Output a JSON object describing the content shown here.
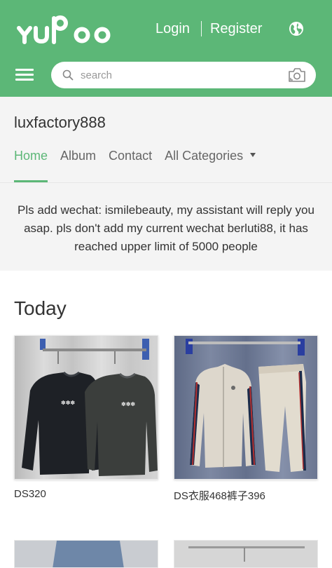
{
  "header": {
    "brand": "yupoo",
    "login_label": "Login",
    "register_label": "Register",
    "language_icon": "globe-icon",
    "menu_icon": "hamburger-icon"
  },
  "search": {
    "placeholder": "search",
    "icon": "search-icon",
    "camera_icon": "camera-icon"
  },
  "store": {
    "name": "luxfactory888",
    "tabs": [
      {
        "label": "Home",
        "active": true
      },
      {
        "label": "Album",
        "active": false
      },
      {
        "label": "Contact",
        "active": false
      },
      {
        "label": "All Categories",
        "active": false
      }
    ],
    "notice": "Pls add wechat:  ismilebeauty, my assistant will reply you asap. pls don't add my current wechat berluti88, it has reached upper limit of 5000 people"
  },
  "main": {
    "section_title": "Today",
    "albums": [
      {
        "title": "DS320"
      },
      {
        "title": "DS衣服468裤子396"
      }
    ]
  },
  "colors": {
    "brand_green": "#5cb777",
    "panel_gray": "#f4f4f4"
  }
}
